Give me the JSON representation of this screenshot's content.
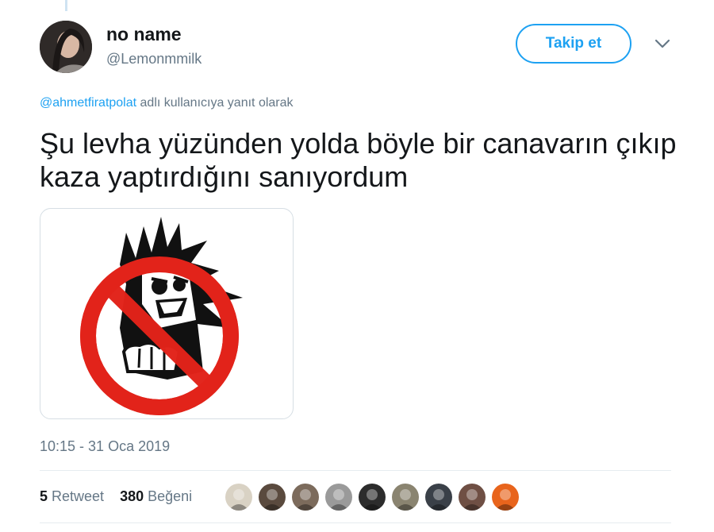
{
  "author": {
    "display_name": "no name",
    "handle": "@Lemonmmilk"
  },
  "follow_button_label": "Takip et",
  "reply_context": {
    "mention": "@ahmetfiratpolat",
    "suffix": " adlı kullanıcıya yanıt olarak"
  },
  "tweet_text": "Şu levha yüzünden yolda böyle bir canavarın çıkıp kaza yaptırdığını sanıyordum",
  "media_description_icon": "no-monster-sign",
  "timestamp": "10:15 - 31 Oca 2019",
  "stats": {
    "retweet_count": "5",
    "retweet_label": " Retweet",
    "like_count": "380",
    "like_label": " Beğeni"
  },
  "colors": {
    "accent": "#1da1f2",
    "muted": "#657786",
    "sign_red": "#e2231a"
  },
  "likers": [
    {
      "icon": "avatar-flowers",
      "bg": "#d9d2c4"
    },
    {
      "icon": "avatar-man",
      "bg": "#5a4a3e"
    },
    {
      "icon": "avatar-man-beard",
      "bg": "#7c6b5c"
    },
    {
      "icon": "avatar-bw",
      "bg": "#9a9a9a"
    },
    {
      "icon": "avatar-dark",
      "bg": "#2c2c2c"
    },
    {
      "icon": "avatar-building",
      "bg": "#8a8470"
    },
    {
      "icon": "avatar-group",
      "bg": "#3a4048"
    },
    {
      "icon": "avatar-woman",
      "bg": "#6f4f44"
    },
    {
      "icon": "avatar-sunset",
      "bg": "#e8641c"
    }
  ]
}
